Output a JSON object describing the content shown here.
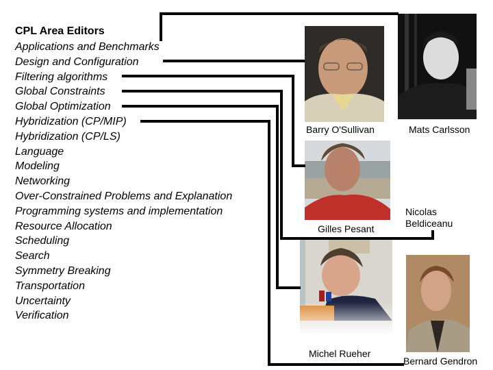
{
  "title": "CPL Area Editors",
  "areas": [
    "Applications and Benchmarks",
    "Design and Configuration",
    "Filtering algorithms",
    "Global Constraints",
    "Global Optimization",
    "Hybridization (CP/MIP)",
    "Hybridization (CP/LS)",
    "Language",
    "Modeling",
    "Networking",
    "Over-Constrained Problems and Explanation",
    "Programming systems and implementation",
    "Resource Allocation",
    "Scheduling",
    "Search",
    "Symmetry Breaking",
    "Transportation",
    "Uncertainty",
    "Verification"
  ],
  "editors": {
    "barry": {
      "name": "Barry O'Sullivan",
      "photo": "portrait-photo"
    },
    "mats": {
      "name": "Mats Carlsson",
      "photo": "portrait-photo"
    },
    "gilles": {
      "name": "Gilles Pesant",
      "photo": "portrait-photo"
    },
    "nicolas": {
      "name_line1": "Nicolas",
      "name_line2": "Beldiceanu"
    },
    "michel": {
      "name": "Michel Rueher",
      "photo": "portrait-photo"
    },
    "bernard": {
      "name": "Bernard Gendron",
      "photo": "portrait-photo"
    }
  },
  "connections": [
    {
      "area": "Applications and Benchmarks",
      "editor": "Mats Carlsson"
    },
    {
      "area": "Design and Configuration",
      "editor": "Barry O'Sullivan"
    },
    {
      "area": "Filtering algorithms",
      "editor": "Gilles Pesant"
    },
    {
      "area": "Global Constraints",
      "editor": "Nicolas Beldiceanu"
    },
    {
      "area": "Global Optimization",
      "editor": "Michel Rueher"
    },
    {
      "area": "Hybridization (CP/MIP)",
      "editor": "Bernard Gendron"
    }
  ],
  "colors": {
    "line": "#000000",
    "background": "#ffffff"
  }
}
